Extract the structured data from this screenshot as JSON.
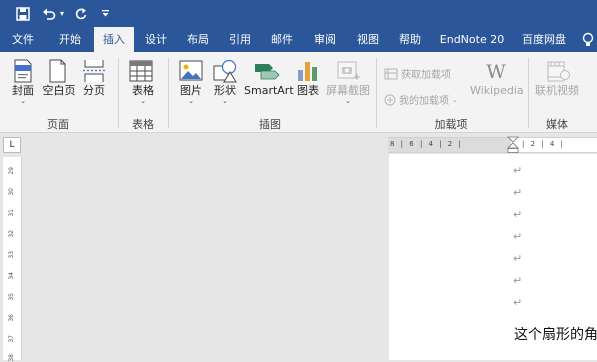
{
  "qat": {
    "save": "save-icon",
    "undo": "undo-icon",
    "redo": "repeat-icon",
    "customize": "customize-icon"
  },
  "tabs": [
    {
      "label": "文件"
    },
    {
      "label": "开始"
    },
    {
      "label": "插入"
    },
    {
      "label": "设计"
    },
    {
      "label": "布局"
    },
    {
      "label": "引用"
    },
    {
      "label": "邮件"
    },
    {
      "label": "审阅"
    },
    {
      "label": "视图"
    },
    {
      "label": "帮助"
    },
    {
      "label": "EndNote 20"
    },
    {
      "label": "百度网盘"
    }
  ],
  "ribbon": {
    "pages": {
      "cover": "封面",
      "blank": "空白页",
      "break": "分页",
      "group": "页面"
    },
    "tables": {
      "table": "表格",
      "group": "表格"
    },
    "illustrations": {
      "pictures": "图片",
      "shapes": "形状",
      "smartart": "SmartArt",
      "chart": "图表",
      "screenshot": "屏幕截图",
      "group": "插图"
    },
    "addins": {
      "get": "获取加载项",
      "my": "我的加载项",
      "wikipedia": "Wikipedia",
      "group": "加载项"
    },
    "media": {
      "video": "联机视频",
      "group": "媒体"
    }
  },
  "ruler": {
    "corner": "L",
    "horizontal_left": "8 | 6 | 4 | 2 |",
    "horizontal_right": "| 2 | 4 |",
    "vertical": [
      "29",
      "30",
      "31",
      "32",
      "33",
      "34",
      "35",
      "36",
      "37",
      "38"
    ]
  },
  "document": {
    "para_mark": "↵",
    "text": "这个扇形的角"
  },
  "colors": {
    "brand": "#2b579a",
    "ribbon": "#f3f3f3"
  }
}
